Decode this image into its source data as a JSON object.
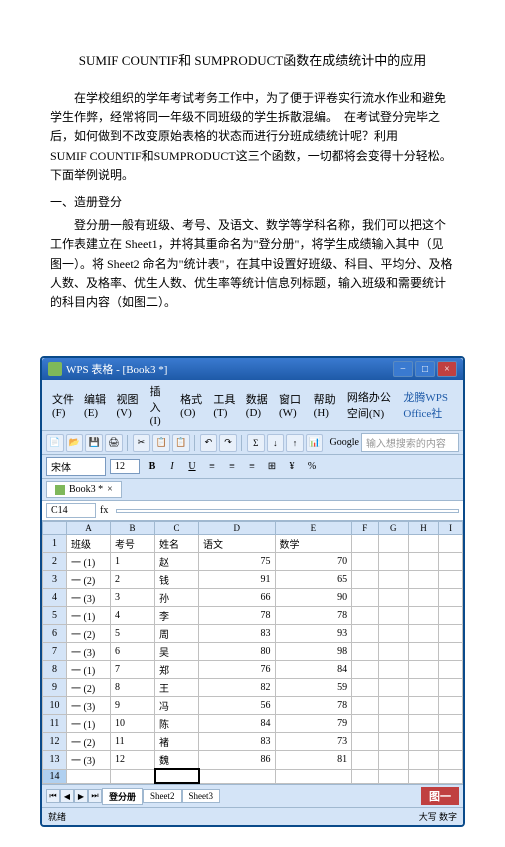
{
  "doc": {
    "title": "SUMIF COUNTIF和 SUMPRODUCT函数在成绩统计中的应用",
    "para1": "在学校组织的学年考试考务工作中，为了便于评卷实行流水作业和避免学生作弊，经常将同一年级不同班级的学生拆散混编。　在考试登分完毕之后，如何做到不改变原始表格的状态而进行分班成绩统计呢？利用　　SUMIF COUNTIF和SUMPRODUCT这三个函数，一切都将会变得十分轻松。下面举例说明。",
    "section1": "一、造册登分",
    "para2": "登分册一般有班级、考号、及语文、数学等学科名称，我们可以把这个工作表建立在 Sheet1，并将其重命名为\"登分册\"，将学生成绩输入其中（见图一）。将 Sheet2 命名为\"统计表\"，在其中设置好班级、科目、平均分、及格人数、及格率、优生人数、优生率等统计信息列标题，输入班级和需要统计的科目内容（如图二）。"
  },
  "app": {
    "title": "WPS 表格 - [Book3 *]",
    "menus": [
      "文件(F)",
      "编辑(E)",
      "视图(V)",
      "插入(I)",
      "格式(O)",
      "工具(T)",
      "数据(D)",
      "窗口(W)",
      "帮助(H)",
      "网络办公空间(N)"
    ],
    "menu_right": "龙腾WPS Office社",
    "search_placeholder": "输入想搜索的内容",
    "google": "Google",
    "font": "宋体",
    "size": "12",
    "doc_tab": "Book3 *",
    "cell_ref": "C14",
    "sheets": {
      "active": "登分册",
      "others": [
        "Sheet2",
        "Sheet3"
      ]
    },
    "fig_label": "图一",
    "status_left": "就绪",
    "status_right": "大写 数字"
  },
  "chart_data": {
    "type": "table",
    "headers_row": [
      "A",
      "B",
      "C",
      "D",
      "E",
      "F",
      "G",
      "H",
      "I"
    ],
    "columns": [
      "班级",
      "考号",
      "姓名",
      "语文",
      "数学"
    ],
    "rows": [
      {
        "r": 1,
        "班级": "班级",
        "考号": "考号",
        "姓名": "姓名",
        "语文": "语文",
        "数学": "数学"
      },
      {
        "r": 2,
        "班级": "一 (1)",
        "考号": "1",
        "姓名": "赵",
        "语文": 75,
        "数学": 70
      },
      {
        "r": 3,
        "班级": "一 (2)",
        "考号": "2",
        "姓名": "钱",
        "语文": 91,
        "数学": 65
      },
      {
        "r": 4,
        "班级": "一 (3)",
        "考号": "3",
        "姓名": "孙",
        "语文": 66,
        "数学": 90
      },
      {
        "r": 5,
        "班级": "一 (1)",
        "考号": "4",
        "姓名": "李",
        "语文": 78,
        "数学": 78
      },
      {
        "r": 6,
        "班级": "一 (2)",
        "考号": "5",
        "姓名": "周",
        "语文": 83,
        "数学": 93
      },
      {
        "r": 7,
        "班级": "一 (3)",
        "考号": "6",
        "姓名": "吴",
        "语文": 80,
        "数学": 98
      },
      {
        "r": 8,
        "班级": "一 (1)",
        "考号": "7",
        "姓名": "郑",
        "语文": 76,
        "数学": 84
      },
      {
        "r": 9,
        "班级": "一 (2)",
        "考号": "8",
        "姓名": "王",
        "语文": 82,
        "数学": 59
      },
      {
        "r": 10,
        "班级": "一 (3)",
        "考号": "9",
        "姓名": "冯",
        "语文": 56,
        "数学": 78
      },
      {
        "r": 11,
        "班级": "一 (1)",
        "考号": "10",
        "姓名": "陈",
        "语文": 84,
        "数学": 79
      },
      {
        "r": 12,
        "班级": "一 (2)",
        "考号": "11",
        "姓名": "褚",
        "语文": 83,
        "数学": 73
      },
      {
        "r": 13,
        "班级": "一 (3)",
        "考号": "12",
        "姓名": "魏",
        "语文": 86,
        "数学": 81
      },
      {
        "r": 14,
        "班级": "",
        "考号": "",
        "姓名": "",
        "语文": "",
        "数学": ""
      }
    ]
  }
}
